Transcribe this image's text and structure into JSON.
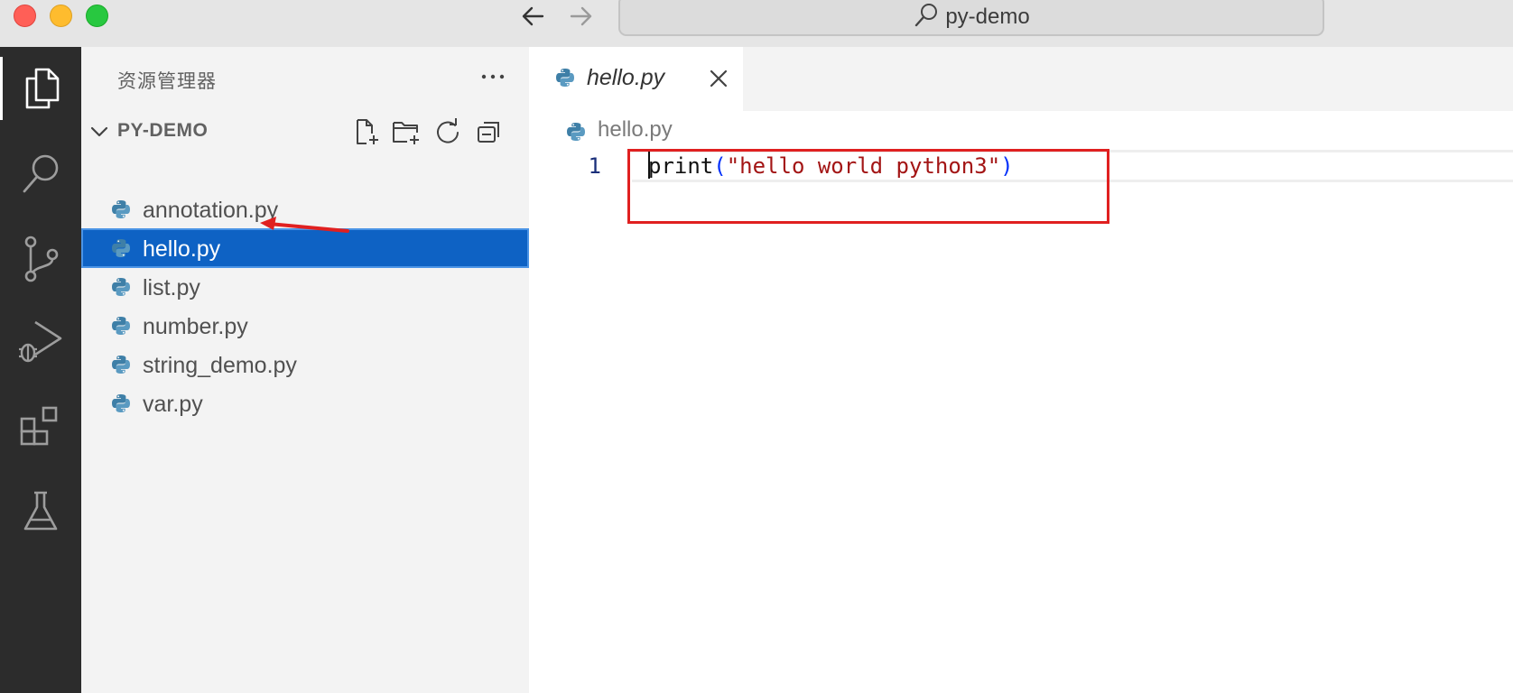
{
  "window": {
    "search_text": "py-demo"
  },
  "activity_bar": {
    "items": [
      {
        "icon": "files-icon",
        "active": true
      },
      {
        "icon": "search-icon",
        "active": false
      },
      {
        "icon": "source-control-icon",
        "active": false
      },
      {
        "icon": "run-debug-icon",
        "active": false
      },
      {
        "icon": "extensions-icon",
        "active": false
      },
      {
        "icon": "testing-icon",
        "active": false
      }
    ]
  },
  "sidebar": {
    "title": "资源管理器",
    "folder": {
      "name": "PY-DEMO",
      "expanded": true
    },
    "files": [
      {
        "name": "annotation.py",
        "selected": false
      },
      {
        "name": "hello.py",
        "selected": true
      },
      {
        "name": "list.py",
        "selected": false
      },
      {
        "name": "number.py",
        "selected": false
      },
      {
        "name": "string_demo.py",
        "selected": false
      },
      {
        "name": "var.py",
        "selected": false
      }
    ]
  },
  "editor": {
    "tab": {
      "label": "hello.py"
    },
    "breadcrumb": "hello.py",
    "lines": [
      {
        "number": "1",
        "tokens": {
          "fn": "print",
          "open": "(",
          "str": "\"hello world python3\"",
          "close": ")"
        }
      }
    ]
  },
  "colors": {
    "selection": "#0e62c4",
    "annotation": "#e02020",
    "activity_bar": "#2c2c2c",
    "sidebar": "#f3f3f3"
  }
}
